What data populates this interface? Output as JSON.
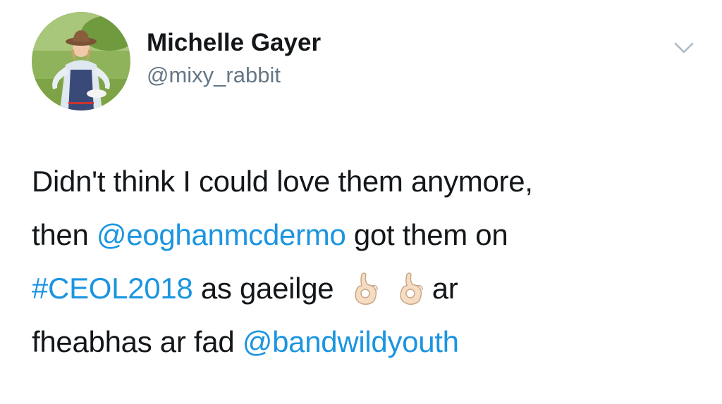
{
  "author": {
    "display_name": "Michelle Gayer",
    "handle": "@mixy_rabbit",
    "avatar_icon": "profile-photo"
  },
  "menu": {
    "icon": "chevron-down-icon"
  },
  "tweet": {
    "line1": "Didn't think I could love them anymore,",
    "line2_pre": "then ",
    "line2_mention": "@eoghanmcdermo",
    "line2_post": " got them on",
    "line3_hashtag": "#CEOL2018",
    "line3_mid": " as gaeilge ",
    "line3_post": "ar",
    "line4_pre": "fheabhas ar fad ",
    "line4_mention": "@bandwildyouth",
    "emoji": [
      "ok-hand-emoji",
      "ok-hand-emoji"
    ]
  },
  "colors": {
    "text": "#14171a",
    "secondary": "#657786",
    "link": "#1b95e0"
  }
}
